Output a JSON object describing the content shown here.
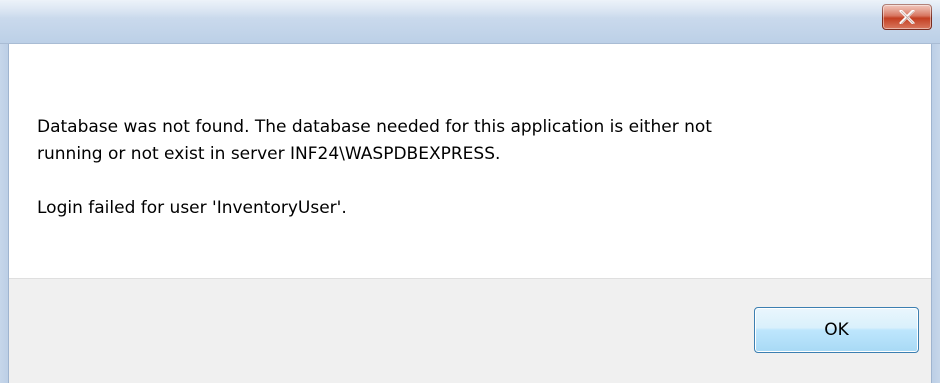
{
  "dialog": {
    "title": "",
    "message_lines": [
      "Database was not found. The database needed for this application is either not",
      "running or not exist in server INF24\\WASPDBEXPRESS.",
      "Login failed for user 'InventoryUser'."
    ],
    "ok_label": "OK"
  },
  "icons": {
    "close": "close-icon"
  },
  "colors": {
    "close_button": "#c33f22",
    "ok_border": "#3c7fb1",
    "footer_bg": "#f0f0f0"
  }
}
